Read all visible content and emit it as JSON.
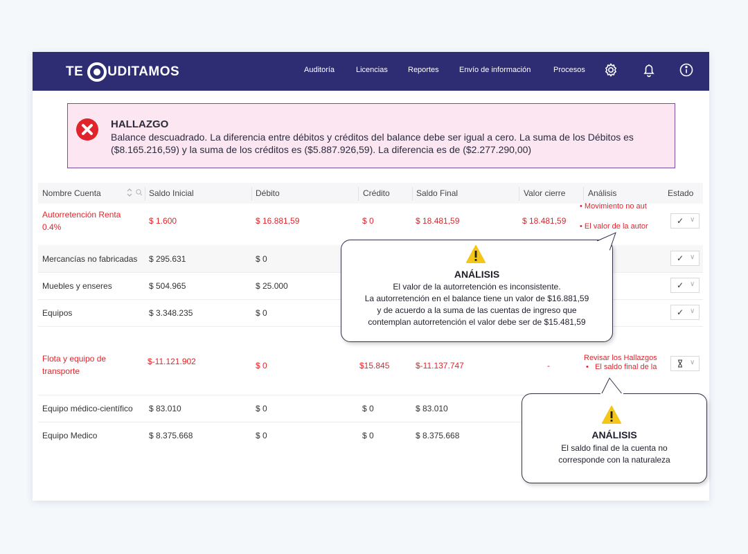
{
  "brand": {
    "name_left": "TE",
    "name_right": "UDITAMOS"
  },
  "nav": {
    "items": [
      "Auditoría",
      "Licencias",
      "Reportes",
      "Envío de información",
      "Procesos"
    ],
    "icons": [
      "gear-icon",
      "bell-icon",
      "info-icon"
    ]
  },
  "alert": {
    "title": "HALLAZGO",
    "text": "Balance descuadrado. La diferencia entre débitos y créditos del balance debe ser igual a cero. La suma de los Débitos es ($8.165.216,59) y la suma de los créditos es ($5.887.926,59). La diferencia es de ($2.277.290,00)"
  },
  "table": {
    "columns": [
      "Nombre Cuenta",
      "Saldo Inicial",
      "Débito",
      "Crédito",
      "Saldo Final",
      "Valor cierre",
      "Análisis",
      "Estado"
    ],
    "rows": [
      {
        "name": "Autorretención Renta 0.4%",
        "saldo_inicial": "$ 1.600",
        "debito": "$ 16.881,59",
        "credito": "$ 0",
        "saldo_final": "$ 18.481,59",
        "valor_cierre": "$ 18.481,59",
        "analisis": [
          "Movimiento no aut",
          "El valor de la autor"
        ]
      },
      {
        "name": "Mercancías no fabricadas",
        "saldo_inicial": "$ 295.631",
        "debito": "$ 0"
      },
      {
        "name": "Muebles y enseres",
        "saldo_inicial": "$ 504.965",
        "debito": "$ 25.000"
      },
      {
        "name": "Equipos",
        "saldo_inicial": "$ 3.348.235",
        "debito": "$ 0"
      },
      {
        "name": "Flota y equipo de transporte",
        "saldo_inicial": "$-11.121.902",
        "debito": "$ 0",
        "credito": "$15.845",
        "saldo_final": "$-11.137.747",
        "valor_cierre": "-",
        "analisis_title": "Revisar los Hallazgos",
        "analisis": [
          "El saldo final de la"
        ]
      },
      {
        "name": "Equipo médico-científico",
        "saldo_inicial": "$ 83.010",
        "debito": "$ 0",
        "credito": "$ 0",
        "saldo_final": "$ 83.010"
      },
      {
        "name": "Equipo Medico",
        "saldo_inicial": "$ 8.375.668",
        "debito": "$ 0",
        "credito": "$ 0",
        "saldo_final": "$ 8.375.668"
      }
    ],
    "status_check": "✓",
    "status_chevron": "∨"
  },
  "tooltip1": {
    "title": "ANÁLISIS",
    "lines": [
      "El valor de la autorretención es inconsistente.",
      "La autorretención en el balance tiene un valor de $16.881,59",
      "y de acuerdo a la suma de las cuentas de ingreso que",
      "contemplan autorretención el valor debe ser de $15.481,59"
    ]
  },
  "tooltip2": {
    "title": "ANÁLISIS",
    "lines": [
      "El saldo final de la cuenta no",
      "corresponde con la naturaleza"
    ]
  },
  "colors": {
    "nav": "#2e2d74",
    "alert_bg": "#fce6f1",
    "alert_border": "#7b4b9c",
    "error_red": "#e0242b",
    "warning_yellow": "#f5c518"
  }
}
